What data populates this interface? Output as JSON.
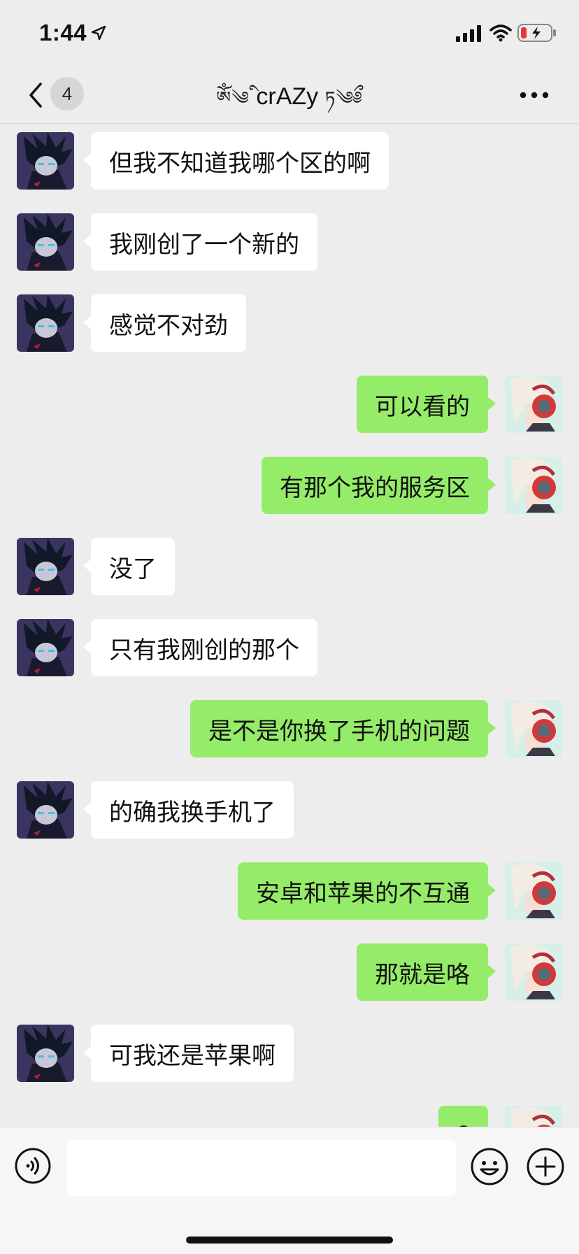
{
  "status_bar": {
    "time": "1:44"
  },
  "header": {
    "back_count": "4",
    "title_prefix": "ༀ༄ི",
    "title_main": "crAZy",
    "title_suffix": "ཏ༄ྀ༅"
  },
  "messages": [
    {
      "side": "left",
      "text": "但我不知道我哪个区的啊"
    },
    {
      "side": "left",
      "text": "我刚创了一个新的"
    },
    {
      "side": "left",
      "text": "感觉不对劲"
    },
    {
      "side": "right",
      "text": "可以看的"
    },
    {
      "side": "right",
      "text": "有那个我的服务区"
    },
    {
      "side": "left",
      "text": "没了"
    },
    {
      "side": "left",
      "text": "只有我刚创的那个"
    },
    {
      "side": "right",
      "text": "是不是你换了手机的问题"
    },
    {
      "side": "left",
      "text": "的确我换手机了"
    },
    {
      "side": "right",
      "text": "安卓和苹果的不互通"
    },
    {
      "side": "right",
      "text": "那就是咯"
    },
    {
      "side": "left",
      "text": "可我还是苹果啊"
    },
    {
      "side": "right",
      "text": "?"
    }
  ],
  "input": {
    "value": "",
    "placeholder": ""
  },
  "colors": {
    "background": "#ededed",
    "outgoing_bubble": "#95ec69",
    "incoming_bubble": "#ffffff",
    "battery_low": "#e53935"
  },
  "icons": {
    "back": "chevron-left-icon",
    "more": "more-horizontal-icon",
    "voice": "voice-icon",
    "emoji": "emoji-icon",
    "plus": "plus-icon"
  }
}
